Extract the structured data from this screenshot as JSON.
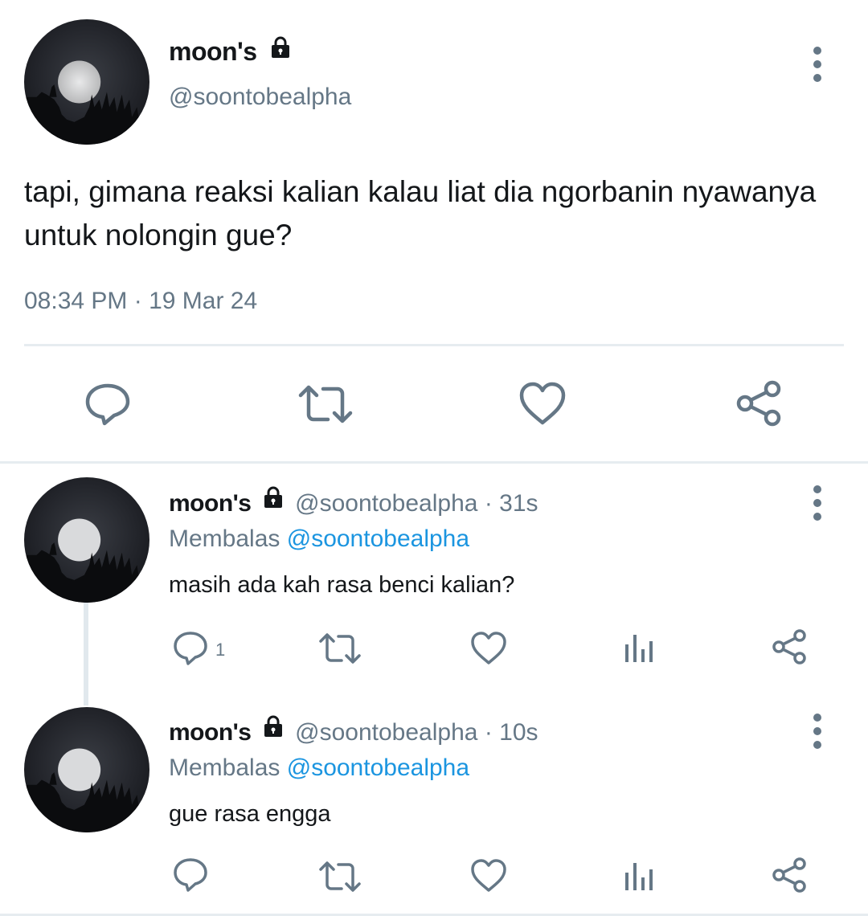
{
  "main_tweet": {
    "display_name": "moon's",
    "handle": "@soontobealpha",
    "text_line1": "tapi, gimana reaksi kalian kalau liat dia ngorbanin nyawanya",
    "text_line2": "untuk nolongin gue?",
    "timestamp": "08:34 PM · 19 Mar 24"
  },
  "replies": [
    {
      "display_name": "moon's",
      "handle": "@soontobealpha",
      "separator": "·",
      "age": "31s",
      "replying_prefix": "Membalas",
      "replying_to": "@soontobealpha",
      "text": "masih ada kah rasa benci kalian?",
      "reply_count": "1"
    },
    {
      "display_name": "moon's",
      "handle": "@soontobealpha",
      "separator": "·",
      "age": "10s",
      "replying_prefix": "Membalas",
      "replying_to": "@soontobealpha",
      "text": "gue rasa engga",
      "reply_count": ""
    }
  ],
  "colors": {
    "text": "#14171a",
    "muted": "#657786",
    "link": "#1b95e0",
    "divider": "#e6ecf0"
  },
  "icons": [
    "lock-icon",
    "more-vertical-icon",
    "reply-icon",
    "retweet-icon",
    "like-icon",
    "share-icon",
    "analytics-icon"
  ]
}
